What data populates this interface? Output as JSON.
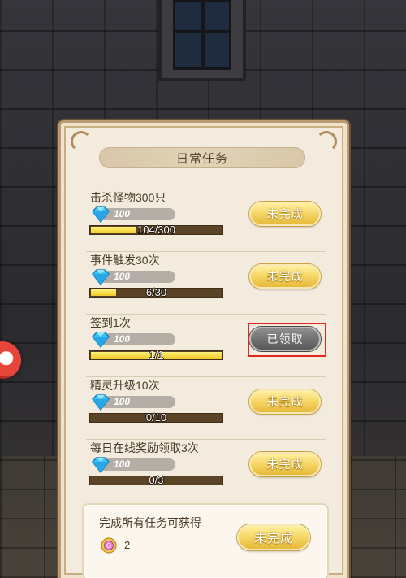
{
  "panel": {
    "title": "日常任务"
  },
  "tasks": [
    {
      "name": "击杀怪物300只",
      "reward": "100",
      "progress_text": "104/300",
      "progress_fraction": 0.347,
      "button": "未完成",
      "button_state": "incomplete"
    },
    {
      "name": "事件触发30次",
      "reward": "100",
      "progress_text": "6/30",
      "progress_fraction": 0.2,
      "button": "未完成",
      "button_state": "incomplete"
    },
    {
      "name": "签到1次",
      "reward": "100",
      "progress_text": "1/1",
      "progress_fraction": 1.0,
      "button": "已领取",
      "button_state": "claimed"
    },
    {
      "name": "精灵升级10次",
      "reward": "100",
      "progress_text": "0/10",
      "progress_fraction": 0.0,
      "button": "未完成",
      "button_state": "incomplete"
    },
    {
      "name": "每日在线奖励领取3次",
      "reward": "100",
      "progress_text": "0/3",
      "progress_fraction": 0.0,
      "button": "未完成",
      "button_state": "incomplete"
    }
  ],
  "all_complete": {
    "title": "完成所有任务可获得",
    "reward_count": "2",
    "reward_icon": "coin-icon",
    "button": "未完成"
  },
  "colors": {
    "button_yellow": "#f5d565",
    "button_gray": "#6f6f6f",
    "progress_fill": "#f0c82a",
    "highlight": "#e0281e"
  }
}
